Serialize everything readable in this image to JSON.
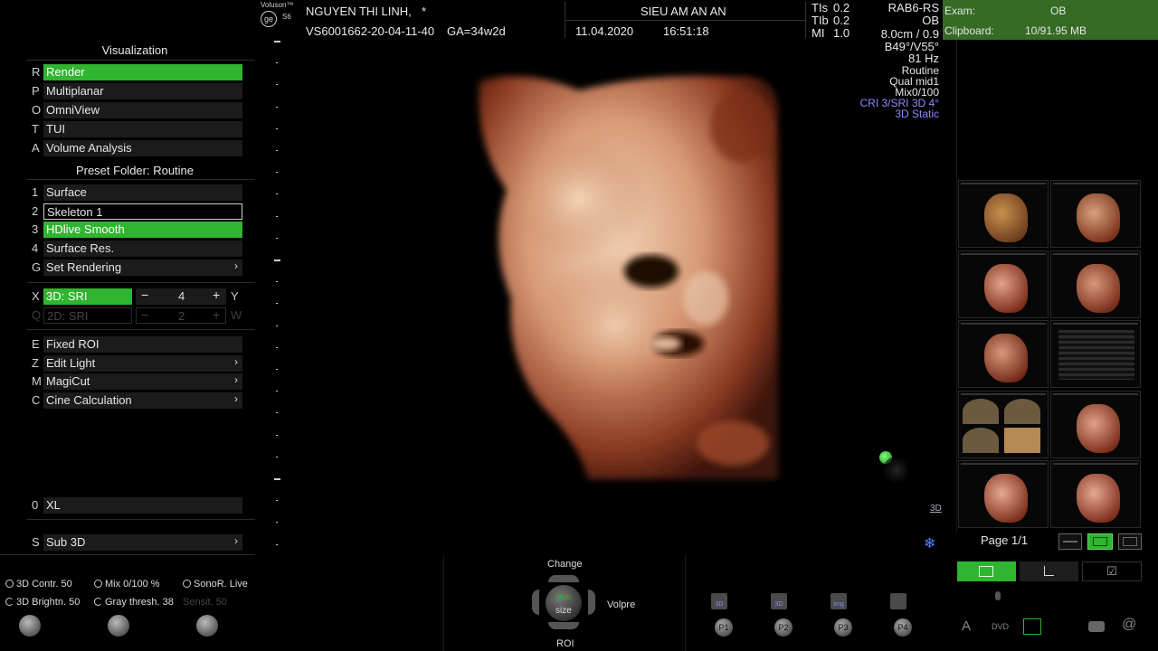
{
  "header": {
    "brand": "Voluson™",
    "model": "S6",
    "patient_name": "NGUYEN THI LINH,",
    "patient_mark": "*",
    "patient_id": "VS6001662-20-04-11-40",
    "ga": "GA=34w2d",
    "study_title": "SIEU AM AN AN",
    "date": "11.04.2020",
    "time": "16:51:18",
    "tis_label": "TIs",
    "tis_value": "0.2",
    "tib_label": "TIb",
    "tib_value": "0.2",
    "mi_label": "MI",
    "mi_value": "1.0"
  },
  "exam_bar": {
    "exam_label": "Exam:",
    "exam_value": "OB",
    "clipboard_label": "Clipboard:",
    "clipboard_value": "10/91.95 MB"
  },
  "probe_info": {
    "probe": "RAB6-RS",
    "app": "OB",
    "depth": "8.0cm / 0.9",
    "angle": "B49°/V55°",
    "frequency": "81 Hz",
    "preset": "Routine",
    "quality": "Qual mid1",
    "mix": "Mix0/100",
    "cri": "CRI 3/SRI 3D 4°",
    "mode": "3D Static"
  },
  "left_panel": {
    "visualization_title": "Visualization",
    "viz_items": [
      {
        "key": "R",
        "label": "Render",
        "state": "active"
      },
      {
        "key": "P",
        "label": "Multiplanar",
        "state": "normal"
      },
      {
        "key": "O",
        "label": "OmniView",
        "state": "normal"
      },
      {
        "key": "T",
        "label": "TUI",
        "state": "normal"
      },
      {
        "key": "A",
        "label": "Volume Analysis",
        "state": "normal"
      }
    ],
    "preset_title": "Preset Folder: Routine",
    "preset_items": [
      {
        "key": "1",
        "label": "Surface",
        "state": "normal"
      },
      {
        "key": "2",
        "label": "Skeleton 1",
        "state": "outlined"
      },
      {
        "key": "3",
        "label": "HDlive Smooth",
        "state": "active"
      },
      {
        "key": "4",
        "label": "Surface Res.",
        "state": "normal"
      },
      {
        "key": "G",
        "label": "Set Rendering",
        "state": "normal",
        "arrow": "›"
      }
    ],
    "sri": {
      "key_left": "X",
      "label": "3D: SRI",
      "value": "4",
      "minus": "−",
      "plus": "+",
      "key_right": "Y"
    },
    "sri2": {
      "key_left": "Q",
      "label": "2D: SRI",
      "value": "2",
      "minus": "−",
      "plus": "+",
      "key_right": "W"
    },
    "tool_items": [
      {
        "key": "E",
        "label": "Fixed ROI",
        "state": "normal"
      },
      {
        "key": "Z",
        "label": "Edit Light",
        "state": "normal",
        "arrow": "›"
      },
      {
        "key": "M",
        "label": "MagiCut",
        "state": "normal",
        "arrow": "›"
      },
      {
        "key": "C",
        "label": "Cine Calculation",
        "state": "normal",
        "arrow": "›"
      }
    ],
    "xl": {
      "key": "0",
      "label": "XL"
    },
    "sub3d": {
      "key": "S",
      "label": "Sub 3D",
      "arrow": "›"
    }
  },
  "viewport": {
    "label_3d": "3D"
  },
  "thumbnails": {
    "page_label": "Page 1/1"
  },
  "bottom": {
    "controls": [
      {
        "label": "3D Contr. 50",
        "icon": "radio-icon"
      },
      {
        "label": "Mix 0/100 %",
        "icon": "radio-icon"
      },
      {
        "label": "SonoR. Live",
        "icon": "radio-icon"
      },
      {
        "label": "3D Brightn. 50",
        "icon": "arc-icon"
      },
      {
        "label": "Gray thresh. 38",
        "icon": "arc-icon"
      },
      {
        "label": "Sensit. 50",
        "icon": "none"
      }
    ],
    "trackball": {
      "top": "Change",
      "center_top": "pos",
      "center_bottom": "size",
      "bottom": "ROI",
      "right": "Volpre"
    },
    "p_buttons": [
      "P1",
      "P2",
      "P3",
      "P4"
    ],
    "p_icons": [
      "3D",
      "3D",
      "Img",
      ""
    ],
    "right_icons": [
      "A",
      "DVD"
    ],
    "colors": {
      "accent_green": "#2fb52f",
      "header_green": "#356b23",
      "probe_blue": "#8a8aff"
    }
  }
}
